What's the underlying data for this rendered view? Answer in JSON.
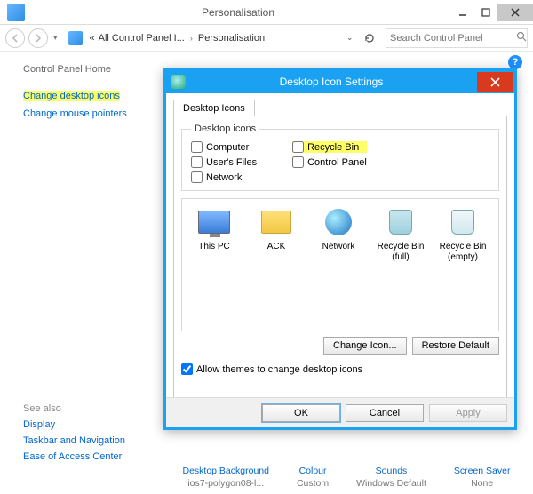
{
  "window": {
    "title": "Personalisation",
    "min": "–",
    "max": "□",
    "close": "×"
  },
  "nav": {
    "crumb1_sep": "«",
    "crumb1": "All Control Panel I...",
    "crumb2": "Personalisation",
    "search_placeholder": "Search Control Panel",
    "help": "?"
  },
  "sidebar": {
    "home": "Control Panel Home",
    "link1": "Change desktop icons",
    "link2": "Change mouse pointers",
    "seealso_hd": "See also",
    "sa1": "Display",
    "sa2": "Taskbar and Navigation",
    "sa3": "Ease of Access Center"
  },
  "bottom": {
    "c1t": "Desktop Background",
    "c1s": "ios7-polygon08-l...",
    "c2t": "Colour",
    "c2s": "Custom",
    "c3t": "Sounds",
    "c3s": "Windows Default",
    "c4t": "Screen Saver",
    "c4s": "None"
  },
  "dialog": {
    "title": "Desktop Icon Settings",
    "tab": "Desktop Icons",
    "group_label": "Desktop icons",
    "chk_computer": "Computer",
    "chk_users": "User's Files",
    "chk_network": "Network",
    "chk_recycle": "Recycle Bin",
    "chk_cpl": "Control Panel",
    "ico_thispc": "This PC",
    "ico_ack": "ACK",
    "ico_network": "Network",
    "ico_binfull": "Recycle Bin (full)",
    "ico_binempty": "Recycle Bin (empty)",
    "btn_changeicon": "Change Icon...",
    "btn_restore": "Restore Default",
    "allow_themes": "Allow themes to change desktop icons",
    "btn_ok": "OK",
    "btn_cancel": "Cancel",
    "btn_apply": "Apply"
  }
}
